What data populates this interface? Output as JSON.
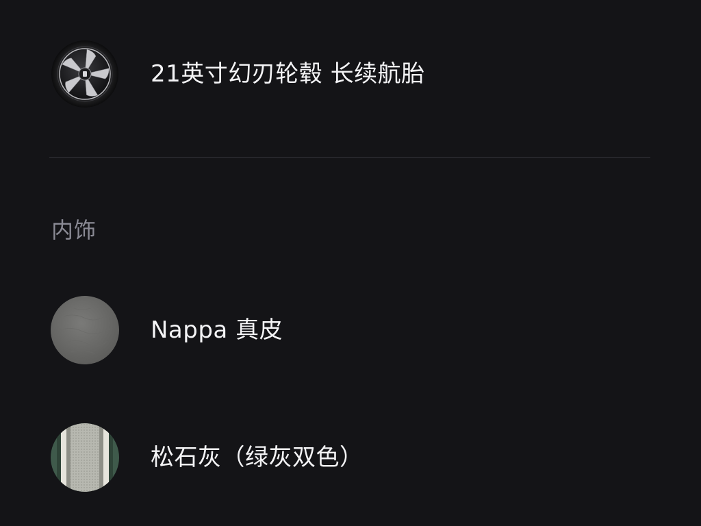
{
  "wheel_option": {
    "label": "21英寸幻刃轮毂 长续航胎",
    "thumb_icon": "wheel-icon"
  },
  "interior_section": {
    "title": "内饰"
  },
  "interior_options": [
    {
      "label": "Nappa 真皮",
      "thumb_icon": "grey-leather-swatch-icon"
    },
    {
      "label": "松石灰（绿灰双色）",
      "thumb_icon": "green-grey-two-tone-swatch-icon"
    }
  ],
  "colors": {
    "background": "#141417",
    "text_primary": "#f4f4f6",
    "text_secondary": "#8a8a94",
    "divider": "#34343a"
  }
}
